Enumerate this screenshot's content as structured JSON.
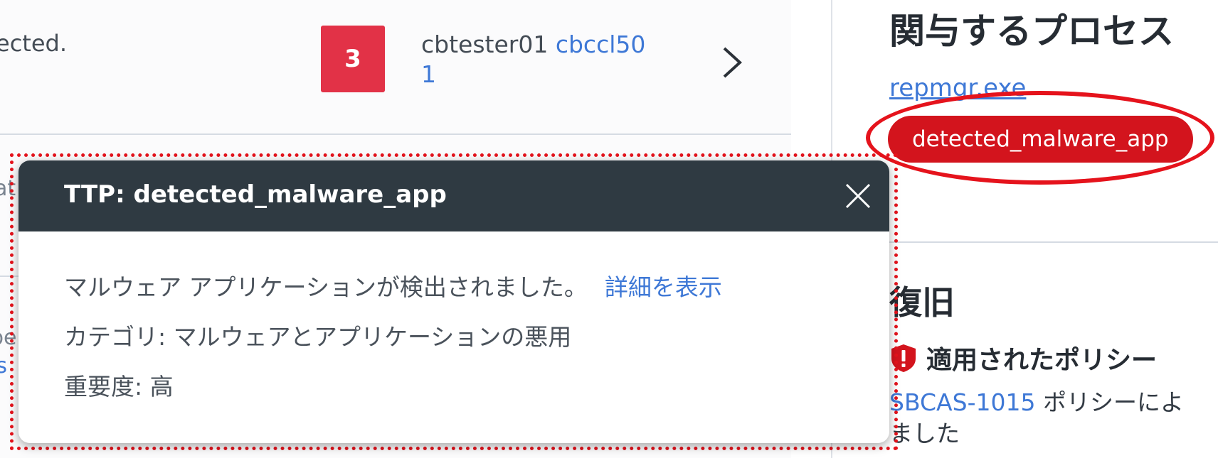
{
  "alert_row": {
    "text_fragment": "ected.",
    "severity": "3",
    "device_user": "cbtester01",
    "device_name": "cbccl50",
    "device_name_cont": "1"
  },
  "left_clipped": {
    "frag_1": "at",
    "frag_2": "pe",
    "frag_3": "ls"
  },
  "right_panel": {
    "process_heading": "関与するプロセス",
    "process_link": "repmgr.exe",
    "ttp_chip": "detected_malware_app",
    "remediation_heading": "復旧",
    "policy_title": "適用されたポリシー",
    "policy_link": "SBCAS-1015",
    "policy_text": " ポリシーによ",
    "policy_text_2": "ました"
  },
  "popover": {
    "title": "TTP: detected_malware_app",
    "description": "マルウェア アプリケーションが検出されました。",
    "details_link": "詳細を表示",
    "category": "カテゴリ:  マルウェアとアプリケーションの悪用",
    "severity": "重要度:  高"
  },
  "colors": {
    "severity_badge": "#e23247",
    "chip": "#d3141d",
    "annotation_red": "#e5131c",
    "popover_header": "#2f3a42",
    "link": "#3e78d6"
  },
  "icons": {
    "chevron": "chevron-right-icon",
    "close": "close-icon",
    "policy": "shield-alert-icon"
  }
}
